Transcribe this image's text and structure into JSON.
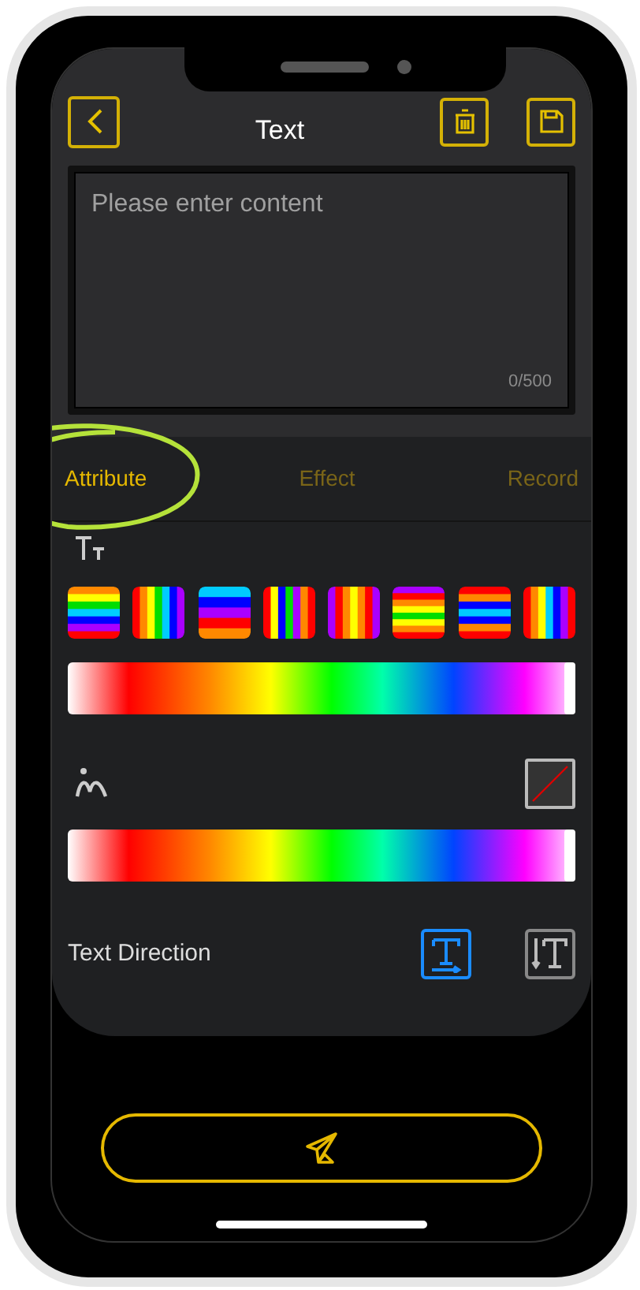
{
  "header": {
    "title": "Text"
  },
  "editor": {
    "placeholder": "Please enter content",
    "counter": "0/500"
  },
  "tabs": [
    {
      "label": "Attribute",
      "selected": true,
      "circled": true
    },
    {
      "label": "Effect",
      "selected": false,
      "circled": false
    },
    {
      "label": "Record",
      "selected": false,
      "circled": false
    }
  ],
  "text_color": {
    "level": 1
  },
  "stroke_color": {
    "level": 1,
    "none_selected": true
  },
  "text_direction": {
    "label": "Text Direction",
    "options": [
      {
        "kind": "horizontal",
        "selected": true
      },
      {
        "kind": "vertical",
        "selected": false
      }
    ]
  }
}
